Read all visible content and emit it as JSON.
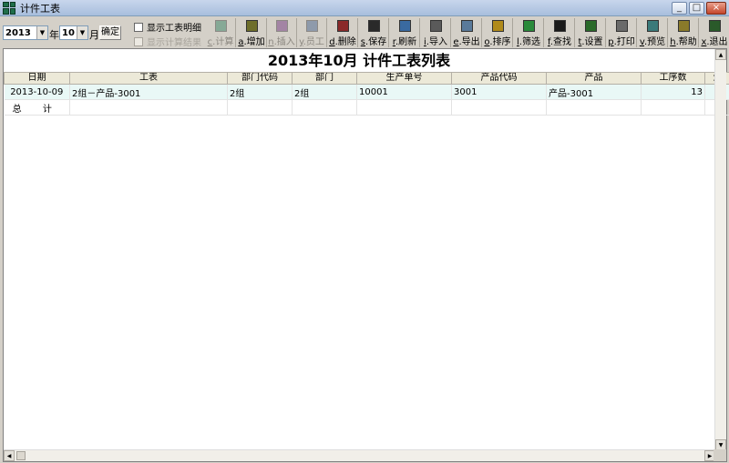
{
  "window": {
    "title": "计件工表",
    "min": "_",
    "max": "□",
    "close": "×"
  },
  "toolbar": {
    "year": "2013",
    "year_unit": "年",
    "month": "10",
    "month_unit": "月",
    "confirm": "确定",
    "checkboxes": [
      {
        "label": "显示工表明细",
        "checked": false,
        "enabled": true
      },
      {
        "label": "显示计算结果",
        "checked": false,
        "enabled": false
      }
    ],
    "buttons": [
      {
        "key": "c",
        "label": ".计算",
        "enabled": false,
        "color": "#2a7a5a"
      },
      {
        "key": "a",
        "label": ".增加",
        "enabled": true,
        "color": "#6e6e2a"
      },
      {
        "key": "n",
        "label": ".插入",
        "enabled": false,
        "color": "#6a2a7a"
      },
      {
        "key": "y",
        "label": ".员工",
        "enabled": false,
        "color": "#3a5a8a"
      },
      {
        "key": "d",
        "label": ".删除",
        "enabled": true,
        "color": "#8a2a2a"
      },
      {
        "key": "s",
        "label": ".保存",
        "enabled": true,
        "color": "#2a2a2a"
      },
      {
        "key": "r",
        "label": ".刷新",
        "enabled": true,
        "color": "#3a6aa0"
      },
      {
        "key": "i",
        "label": ".导入",
        "enabled": true,
        "color": "#5a5a5a"
      },
      {
        "key": "e",
        "label": ".导出",
        "enabled": true,
        "color": "#5a7a9a"
      },
      {
        "key": "o",
        "label": ".排序",
        "enabled": true,
        "color": "#b08a1a"
      },
      {
        "key": "l",
        "label": ".筛选",
        "enabled": true,
        "color": "#2a8a3a"
      },
      {
        "key": "f",
        "label": ".查找",
        "enabled": true,
        "color": "#1a1a1a"
      },
      {
        "key": "t",
        "label": ".设置",
        "enabled": true,
        "color": "#2a6a2a"
      },
      {
        "key": "p",
        "label": ".打印",
        "enabled": true,
        "color": "#6a6a6a"
      },
      {
        "key": "v",
        "label": ".预览",
        "enabled": true,
        "color": "#3a7a7a"
      },
      {
        "key": "h",
        "label": ".帮助",
        "enabled": true,
        "color": "#8a7a2a"
      },
      {
        "key": "x",
        "label": ".退出",
        "enabled": true,
        "color": "#2a5a2a"
      }
    ]
  },
  "sheet": {
    "title": "2013年10月 计件工表列表",
    "columns": [
      "日期",
      "工表",
      "部门代码",
      "部门",
      "生产单号",
      "产品代码",
      "产品",
      "工序数",
      "生"
    ],
    "rows": [
      [
        "2013-10-09",
        "2组－产品-3001",
        "2组",
        "2组",
        "10001",
        "3001",
        "产品-3001",
        "13",
        ""
      ]
    ],
    "total_label": "总 计"
  }
}
